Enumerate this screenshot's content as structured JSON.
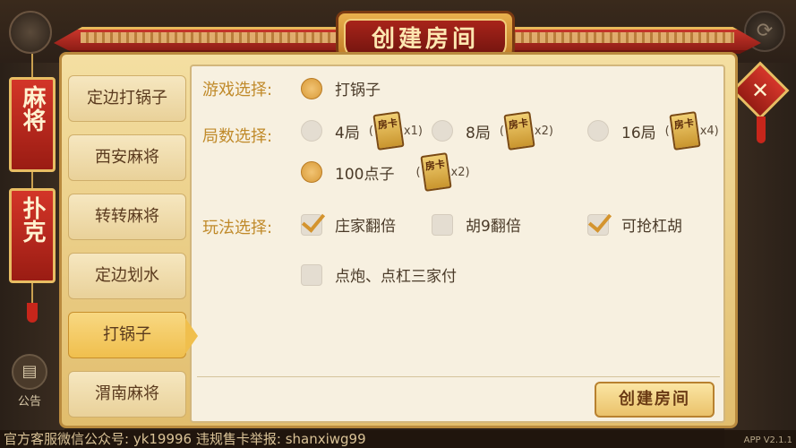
{
  "title": "创建房间",
  "categories": [
    "麻将",
    "扑克"
  ],
  "close_icon": "close-icon",
  "tabs": [
    {
      "label": "定边打锅子",
      "active": false
    },
    {
      "label": "西安麻将",
      "active": false
    },
    {
      "label": "转转麻将",
      "active": false
    },
    {
      "label": "定边划水",
      "active": false
    },
    {
      "label": "打锅子",
      "active": true
    },
    {
      "label": "渭南麻将",
      "active": false
    }
  ],
  "game_select": {
    "label": "游戏选择:",
    "option": "打锅子"
  },
  "rounds_select": {
    "label": "局数选择:",
    "options": [
      {
        "label": "4局",
        "card_text": "房卡",
        "multiplier": "x1)",
        "paren": "(",
        "selected": false
      },
      {
        "label": "8局",
        "card_text": "房卡",
        "multiplier": "x2)",
        "paren": "(",
        "selected": false
      },
      {
        "label": "16局",
        "card_text": "房卡",
        "multiplier": "x4)",
        "paren": "(",
        "selected": false
      },
      {
        "label": "100点子",
        "card_text": "房卡",
        "multiplier": "x2)",
        "paren": "(",
        "selected": true
      }
    ]
  },
  "rules_select": {
    "label": "玩法选择:",
    "options": [
      {
        "label": "庄家翻倍",
        "checked": true
      },
      {
        "label": "胡9翻倍",
        "checked": false
      },
      {
        "label": "可抢杠胡",
        "checked": true
      },
      {
        "label": "点炮、点杠三家付",
        "checked": false
      }
    ]
  },
  "create_button": "创建房间",
  "notice_label": "公告",
  "ticker_text": "官方客服微信公众号: yk19996 违规售卡举报: shanxiwg99",
  "version": "APP V2.1.1",
  "colors": {
    "accent": "#d4942e",
    "label": "#c08a2a",
    "red": "#b8241a"
  }
}
